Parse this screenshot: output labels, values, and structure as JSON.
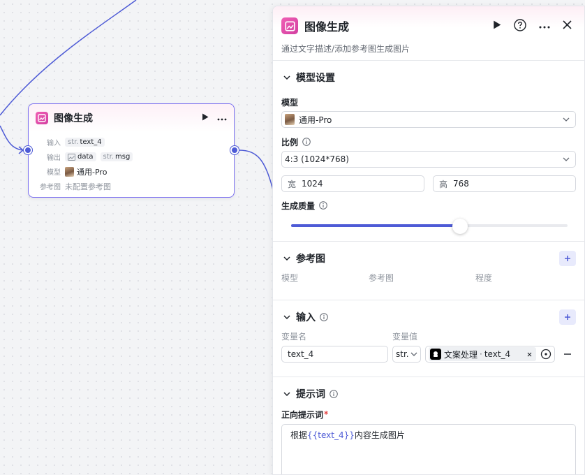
{
  "node": {
    "title": "图像生成",
    "rows": {
      "input_label": "输入",
      "input_chip_prefix": "str.",
      "input_chip_value": "text_4",
      "output_label": "输出",
      "output_chip1": "data",
      "output_chip2_prefix": "str.",
      "output_chip2_value": "msg",
      "model_label": "模型",
      "model_value": "通用-Pro",
      "ref_label": "参考图",
      "ref_value": "未配置参考图"
    }
  },
  "panel": {
    "title": "图像生成",
    "description": "通过文字描述/添加参考图生成图片",
    "model_section": {
      "title": "模型设置",
      "model_label": "模型",
      "model_value": "通用-Pro",
      "ratio_label": "比例",
      "ratio_value": "4:3 (1024*768)",
      "width_prefix": "宽",
      "width_value": "1024",
      "height_prefix": "高",
      "height_value": "768",
      "quality_label": "生成质量",
      "quality_level": 0.61
    },
    "ref_section": {
      "title": "参考图",
      "col_model": "模型",
      "col_ref": "参考图",
      "col_degree": "程度"
    },
    "input_section": {
      "title": "输入",
      "col_name": "变量名",
      "col_value": "变量值",
      "var_name": "text_4",
      "var_type": "str.",
      "ref_source": "文案处理",
      "ref_sep": "·",
      "ref_var": "text_4"
    },
    "prompt_section": {
      "title": "提示词",
      "positive_label": "正向提示词",
      "required_mark": "*",
      "prompt_before": "根据",
      "prompt_var": "{{text_4}}",
      "prompt_after": "内容生成图片"
    }
  },
  "colors": {
    "accent": "#4e5bd6",
    "brand_pink": "#e14aa8",
    "node_border": "#7b6ff0"
  }
}
